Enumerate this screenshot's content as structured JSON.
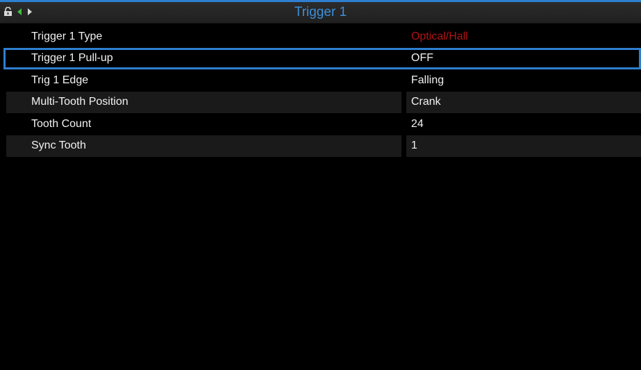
{
  "window": {
    "title": "Trigger 1"
  },
  "toolbar": {
    "icons": [
      "lock-icon",
      "arrow-left-icon",
      "arrow-right-icon"
    ]
  },
  "rows": [
    {
      "label": "Trigger 1 Type",
      "value": "Optical/Hall",
      "value_color": "#b31212"
    },
    {
      "label": "Trigger 1 Pull-up",
      "value": "OFF",
      "selected": true
    },
    {
      "label": "Trig 1 Edge",
      "value": "Falling"
    },
    {
      "label": "Multi-Tooth Position",
      "value": "Crank"
    },
    {
      "label": "Tooth Count",
      "value": "24"
    },
    {
      "label": "Sync Tooth",
      "value": "1"
    }
  ],
  "colors": {
    "accent": "#2f7fd1",
    "title": "#3d8fd8",
    "warning_value": "#b31212",
    "row_alt": "#1a1a1a",
    "background": "#000000"
  }
}
